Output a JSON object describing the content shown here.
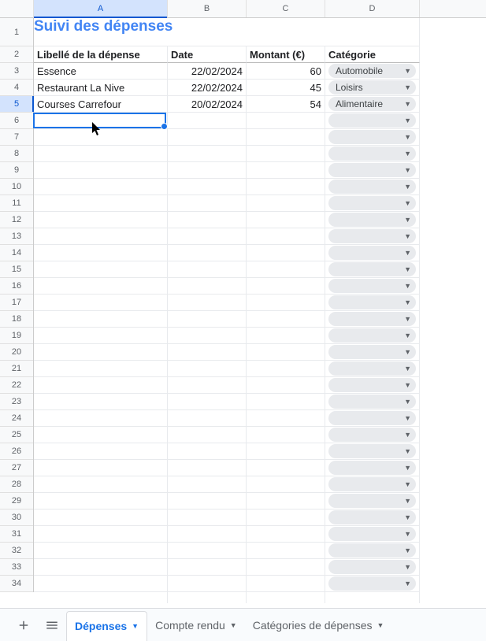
{
  "columns": [
    "A",
    "B",
    "C",
    "D"
  ],
  "title": "Suivi des dépenses",
  "headers": {
    "libelle": "Libellé de la dépense",
    "date": "Date",
    "montant": "Montant (€)",
    "categorie": "Catégorie"
  },
  "rows": [
    {
      "libelle": "Essence",
      "date": "22/02/2024",
      "montant": "60",
      "categorie": "Automobile"
    },
    {
      "libelle": "Restaurant La Nive",
      "date": "22/02/2024",
      "montant": "45",
      "categorie": "Loisirs"
    },
    {
      "libelle": "Courses Carrefour",
      "date": "20/02/2024",
      "montant": "54",
      "categorie": "Alimentaire"
    }
  ],
  "selected_cell": "A5",
  "tabs": {
    "active": "Dépenses",
    "others": [
      "Compte rendu",
      "Catégories de dépenses"
    ]
  },
  "row_count": 35
}
